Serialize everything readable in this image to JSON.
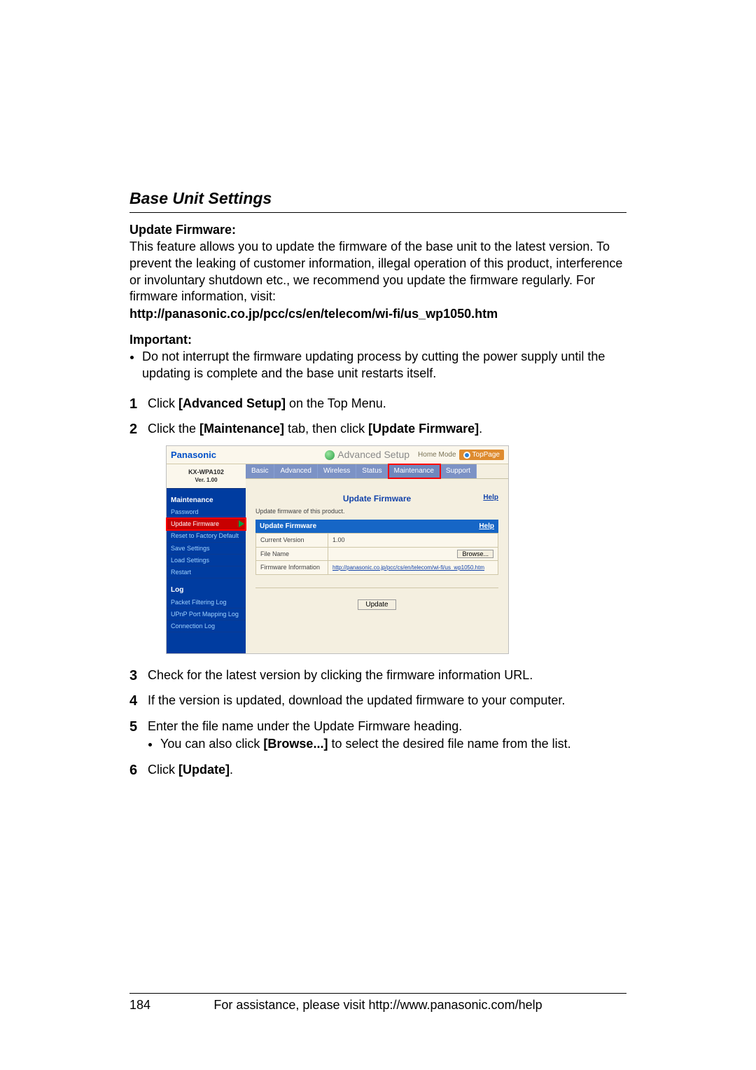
{
  "section_title": "Base Unit Settings",
  "update_firmware": {
    "heading": "Update Firmware:",
    "body": "This feature allows you to update the firmware of the base unit to the latest version. To prevent the leaking of customer information, illegal operation of this product, interference or involuntary shutdown etc., we recommend you update the firmware regularly. For firmware information, visit:",
    "url": "http://panasonic.co.jp/pcc/cs/en/telecom/wi-fi/us_wp1050.htm"
  },
  "important": {
    "heading": "Important:",
    "bullet": "Do not interrupt the firmware updating process by cutting the power supply until the updating is complete and the base unit restarts itself."
  },
  "steps": {
    "s1_a": "Click ",
    "s1_b": "[Advanced Setup]",
    "s1_c": " on the Top Menu.",
    "s2_a": "Click the ",
    "s2_b": "[Maintenance]",
    "s2_c": " tab, then click ",
    "s2_d": "[Update Firmware]",
    "s2_e": ".",
    "s3": "Check for the latest version by clicking the firmware information URL.",
    "s4": "If the version is updated, download the updated firmware to your computer.",
    "s5": "Enter the file name under the Update Firmware heading.",
    "s5_sub_a": "You can also click ",
    "s5_sub_b": "[Browse...]",
    "s5_sub_c": " to select the desired file name from the list.",
    "s6_a": "Click ",
    "s6_b": "[Update]",
    "s6_c": "."
  },
  "screenshot": {
    "brand": "Panasonic",
    "adv_setup": "Advanced Setup",
    "home_mode": "Home Mode",
    "toppage": "TopPage",
    "model": "KX-WPA102",
    "version": "Ver. 1.00",
    "side_cat1": "Maintenance",
    "side_items1": [
      "Password",
      "Update Firmware",
      "Reset to Factory Default",
      "Save Settings",
      "Load Settings",
      "Restart"
    ],
    "side_cat2": "Log",
    "side_items2": [
      "Packet Filtering Log",
      "UPnP Port Mapping Log",
      "Connection Log"
    ],
    "tabs": [
      "Basic",
      "Advanced",
      "Wireless",
      "Status",
      "Maintenance",
      "Support"
    ],
    "uf_title": "Update Firmware",
    "help": "Help",
    "uf_sub": "Update firmware of this product.",
    "strip_title": "Update Firmware",
    "chart_data": {
      "type": "table",
      "rows": [
        {
          "label": "Current Version",
          "value": "1.00"
        },
        {
          "label": "File Name",
          "value": ""
        },
        {
          "label": "Firmware Information",
          "value": "http://panasonic.co.jp/pcc/cs/en/telecom/wi-fi/us_wp1050.htm"
        }
      ],
      "browse_label": "Browse...",
      "update_label": "Update"
    }
  },
  "footer": {
    "page": "184",
    "text": "For assistance, please visit http://www.panasonic.com/help"
  }
}
